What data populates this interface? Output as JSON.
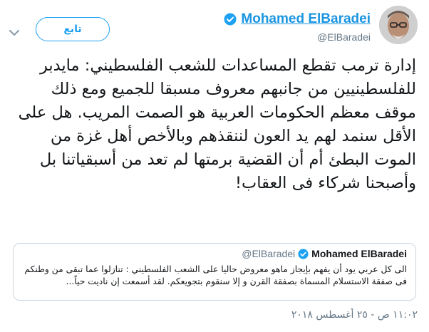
{
  "header": {
    "display_name": "Mohamed ElBaradei",
    "handle": "@ElBaradei",
    "follow_label": "تابع",
    "verified_icon": "verified-badge-icon",
    "colors": {
      "link": "#1b95e0",
      "accent": "#1da1f2",
      "muted": "#657786"
    }
  },
  "tweet": {
    "text": "إدارة ترمب تقطع المساعدات للشعب الفلسطيني: مايدبر للفلسطينيين من جانبهم معروف مسبقا للجميع ومع ذلك موقف معظم الحكومات العربية هو الصمت المريب. هل على الأقل سنمد لهم يد العون لننقذهم وبالأخص أهل غزة من الموت البطئ أم أن القضية برمتها لم تعد من أسبقياتنا بل وأصبحنا شركاء فى العقاب!"
  },
  "quote": {
    "display_name": "Mohamed ElBaradei",
    "handle": "@ElBaradei",
    "text": "الى كل عربي يود أن يفهم بإيجاز  ماهو معروض حاليا على الشعب الفلسطيني : تنازلوا عما تبقى من وطنكم فى صفقة الاستسلام المسماة بصفقة القرن و إلا سنقوم بتجويعكم. لقد أسمعت إن ناديت حياً..."
  },
  "timestamp": "١١:٠٢ ص - ٢٥ أغسطس ٢٠١٨"
}
